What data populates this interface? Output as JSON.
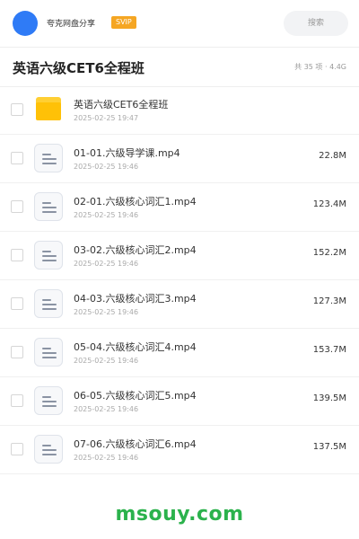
{
  "header": {
    "brand": "夸克网盘分享",
    "badge": "SVIP",
    "search_label": "搜索"
  },
  "folder": {
    "title": "英语六级CET6全程班",
    "meta": "共 35 项 · 4.4G"
  },
  "items": [
    {
      "type": "folder",
      "name": "英语六级CET6全程班",
      "date": "2025-02-25 19:47",
      "size": ""
    },
    {
      "type": "file",
      "name": "01-01.六级导学课.mp4",
      "date": "2025-02-25 19:46",
      "size": "22.8M"
    },
    {
      "type": "file",
      "name": "02-01.六级核心词汇1.mp4",
      "date": "2025-02-25 19:46",
      "size": "123.4M"
    },
    {
      "type": "file",
      "name": "03-02.六级核心词汇2.mp4",
      "date": "2025-02-25 19:46",
      "size": "152.2M"
    },
    {
      "type": "file",
      "name": "04-03.六级核心词汇3.mp4",
      "date": "2025-02-25 19:46",
      "size": "127.3M"
    },
    {
      "type": "file",
      "name": "05-04.六级核心词汇4.mp4",
      "date": "2025-02-25 19:46",
      "size": "153.7M"
    },
    {
      "type": "file",
      "name": "06-05.六级核心词汇5.mp4",
      "date": "2025-02-25 19:46",
      "size": "139.5M"
    },
    {
      "type": "file",
      "name": "07-06.六级核心词汇6.mp4",
      "date": "2025-02-25 19:46",
      "size": "137.5M"
    }
  ],
  "watermark": "msouy.com",
  "colors": {
    "accent": "#2f7bf6",
    "svip": "#f5a623",
    "folder": "#ffc107",
    "watermark": "#2bb24c"
  }
}
